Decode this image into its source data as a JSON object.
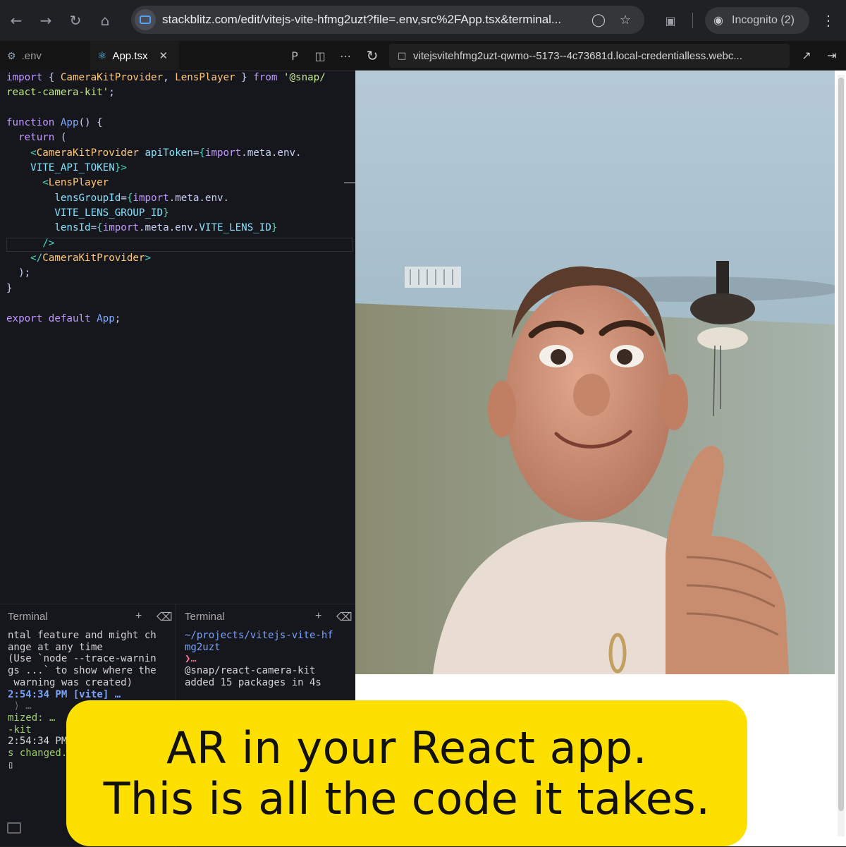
{
  "browser": {
    "url": "stackblitz.com/edit/vitejs-vite-hfmg2uzt?file=.env,src%2FApp.tsx&terminal...",
    "profile_label": "Incognito (2)"
  },
  "editor": {
    "tabs": [
      {
        "label": ".env"
      },
      {
        "label": "App.tsx"
      }
    ]
  },
  "preview": {
    "url": "vitejsvitehfmg2uzt-qwmo--5173--4c73681d.local-credentialless.webc..."
  },
  "terminals": [
    {
      "title": "Terminal",
      "lines": [
        "ntal feature and might ch",
        "ange at any time",
        "(Use `node --trace-warnin",
        "gs ...` to show where the",
        " warning was created)",
        "2:54:34 PM [vite] …",
        " ⟩ …",
        "mized: …",
        "-kit",
        "2:54:34 PM",
        "",
        "s changed.",
        "▯"
      ]
    },
    {
      "title": "Terminal",
      "lines": [
        "~/projects/vitejs-vite-hf",
        "mg2uzt",
        "❯…",
        "@snap/react-camera-kit",
        "",
        "added 15 packages in 4s"
      ]
    }
  ],
  "caption": {
    "line1": "AR in your React app.",
    "line2": "This is all the code it takes."
  },
  "colors": {
    "banner": "#fee000",
    "editor_bg": "#16171d"
  }
}
